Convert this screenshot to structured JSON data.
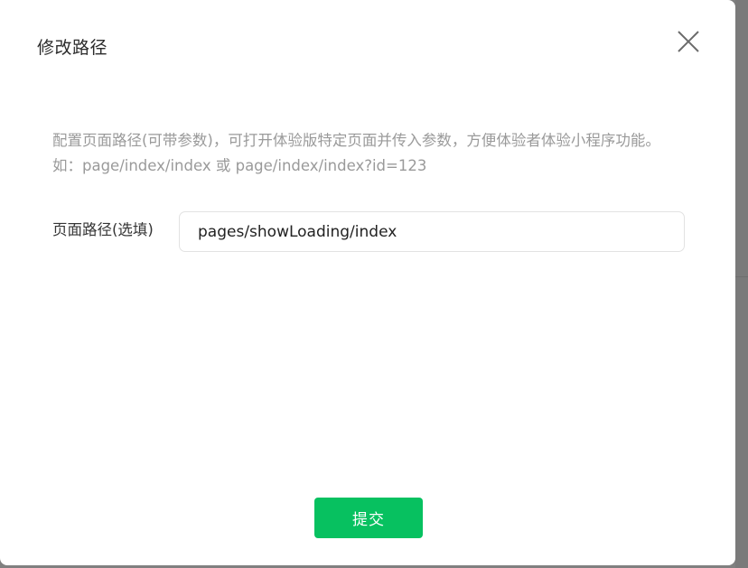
{
  "dialog": {
    "title": "修改路径",
    "close_icon": "close-icon",
    "description": "配置页面路径(可带参数)，可打开体验版特定页面并传入参数，方便体验者体验小程序功能。如：page/index/index 或 page/index/index?id=123",
    "field": {
      "label": "页面路径(选填)",
      "value": "pages/showLoading/index",
      "placeholder": ""
    },
    "submit_label": "提交"
  },
  "colors": {
    "accent": "#07c160",
    "backdrop": "#808080",
    "description_text": "#9a9a9a"
  }
}
